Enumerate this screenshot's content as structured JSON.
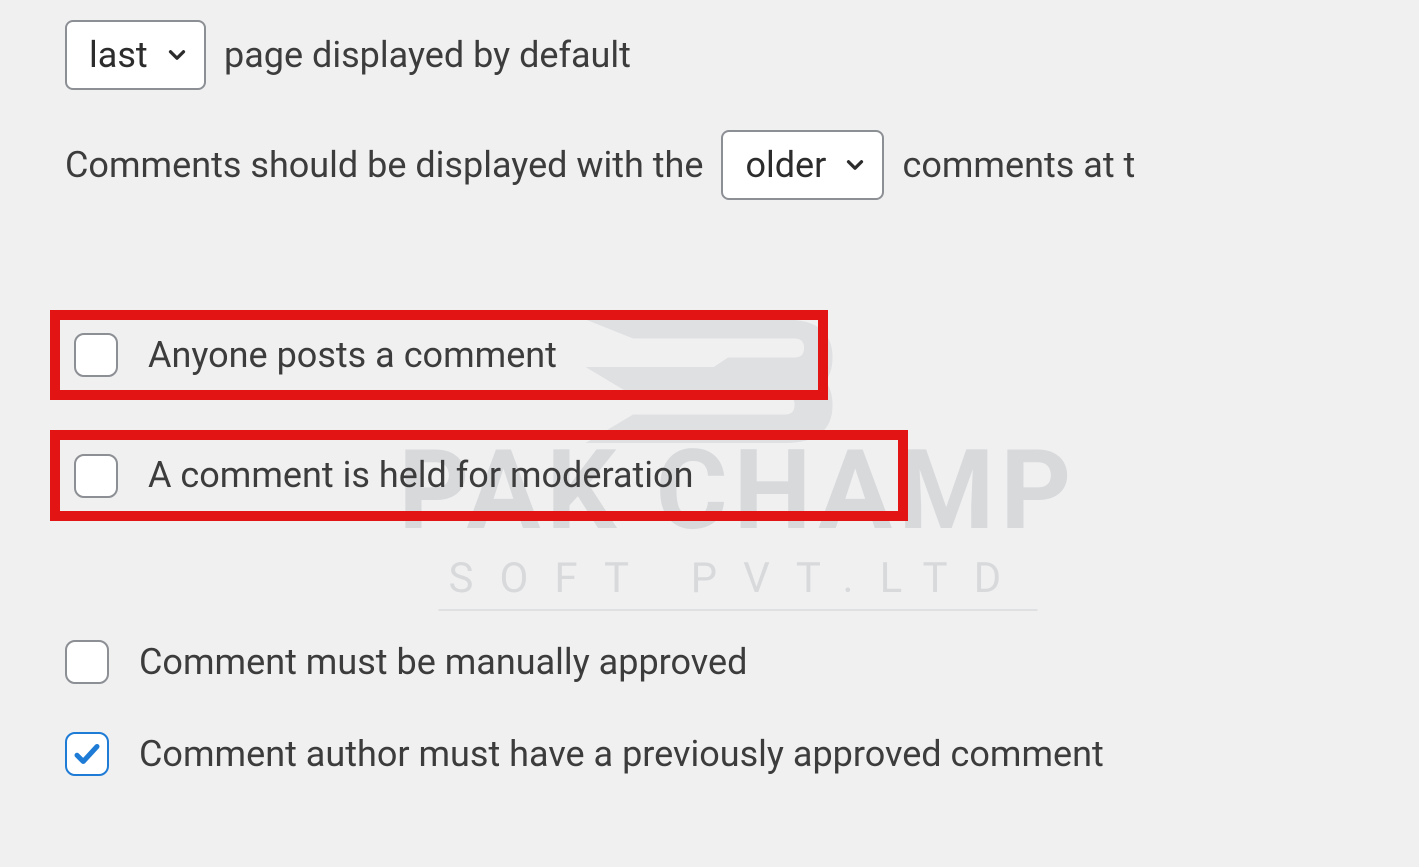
{
  "pagination": {
    "default_page_select": "last",
    "after_select_label": "page displayed by default"
  },
  "ordering": {
    "prefix_label": "Comments should be displayed with the",
    "order_select": "older",
    "suffix_label": "comments at t"
  },
  "email_me": {
    "anyone_posts": {
      "checked": false,
      "label": "Anyone posts a comment"
    },
    "held_moderation": {
      "checked": false,
      "label": "A comment is held for moderation"
    }
  },
  "before_appears": {
    "manually_approved": {
      "checked": false,
      "label": "Comment must be manually approved"
    },
    "prev_approved": {
      "checked": true,
      "label": "Comment author must have a previously approved comment"
    }
  },
  "watermark": {
    "line1": "PAK CHAMP",
    "line2": "SOFT PVT.LTD"
  }
}
